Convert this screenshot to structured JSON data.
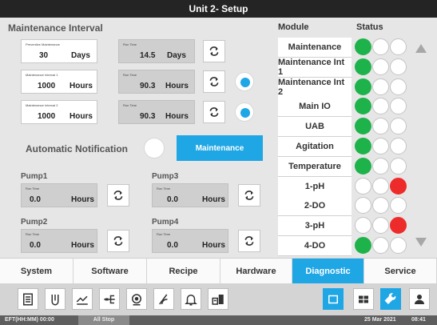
{
  "title": "Unit 2- Setup",
  "maintenance": {
    "section_title": "Maintenance Interval",
    "rows": [
      {
        "label": "Preventive Maintenance",
        "value": "30",
        "unit": "Days",
        "runtime_label": "Run Time",
        "runtime_value": "14.5",
        "runtime_unit": "Days",
        "radio": null
      },
      {
        "label": "Maintenance Interval 1",
        "value": "1000",
        "unit": "Hours",
        "runtime_label": "Run Time",
        "runtime_value": "90.3",
        "runtime_unit": "Hours",
        "radio": true
      },
      {
        "label": "Maintenance Interval 2",
        "value": "1000",
        "unit": "Hours",
        "runtime_label": "Run Time",
        "runtime_value": "90.3",
        "runtime_unit": "Hours",
        "radio": true
      }
    ],
    "auto_notification_label": "Automatic Notification",
    "auto_notification_on": false,
    "maintenance_button": "Maintenance"
  },
  "pumps": [
    {
      "name": "Pump1",
      "runtime_label": "Run Time",
      "value": "0.0",
      "unit": "Hours"
    },
    {
      "name": "Pump3",
      "runtime_label": "Run Time",
      "value": "0.0",
      "unit": "Hours"
    },
    {
      "name": "Pump2",
      "runtime_label": "Run Time",
      "value": "0.0",
      "unit": "Hours"
    },
    {
      "name": "Pump4",
      "runtime_label": "Run Time",
      "value": "0.0",
      "unit": "Hours"
    }
  ],
  "modules": {
    "header_module": "Module",
    "header_status": "Status",
    "items": [
      {
        "name": "Maintenance",
        "status": [
          "green",
          "off",
          "off"
        ]
      },
      {
        "name": "Maintenance Int 1",
        "status": [
          "green",
          "off",
          "off"
        ]
      },
      {
        "name": "Maintenance Int 2",
        "status": [
          "green",
          "off",
          "off"
        ]
      },
      {
        "name": "Main IO",
        "status": [
          "green",
          "off",
          "off"
        ]
      },
      {
        "name": "UAB",
        "status": [
          "green",
          "off",
          "off"
        ]
      },
      {
        "name": "Agitation",
        "status": [
          "green",
          "off",
          "off"
        ]
      },
      {
        "name": "Temperature",
        "status": [
          "green",
          "off",
          "off"
        ]
      },
      {
        "name": "1-pH",
        "status": [
          "off",
          "off",
          "red"
        ]
      },
      {
        "name": "2-DO",
        "status": [
          "off",
          "off",
          "off"
        ]
      },
      {
        "name": "3-pH",
        "status": [
          "off",
          "off",
          "red"
        ]
      },
      {
        "name": "4-DO",
        "status": [
          "green",
          "off",
          "off"
        ]
      }
    ]
  },
  "tabs": [
    {
      "label": "System",
      "active": false
    },
    {
      "label": "Software",
      "active": false
    },
    {
      "label": "Recipe",
      "active": false
    },
    {
      "label": "Hardware",
      "active": false
    },
    {
      "label": "Diagnostic",
      "active": true
    },
    {
      "label": "Service",
      "active": false
    }
  ],
  "toolbar_icons": [
    "clipboard-icon",
    "vessel-icon",
    "trend-chart-icon",
    "network-icon",
    "pump-icon",
    "calibration-icon",
    "alarm-bell-icon",
    "data-export-icon",
    "window-icon",
    "grid-view-icon",
    "wrench-icon",
    "user-icon"
  ],
  "status_bar": {
    "eft": "EFT(HH:MM) 00:00",
    "state": "All Stop",
    "date": "25 Mar 2021",
    "time": "08:41"
  },
  "colors": {
    "accent": "#1fa6e5",
    "ok": "#1eb34a",
    "alarm": "#ee2b2b",
    "title_bar": "#242424"
  }
}
